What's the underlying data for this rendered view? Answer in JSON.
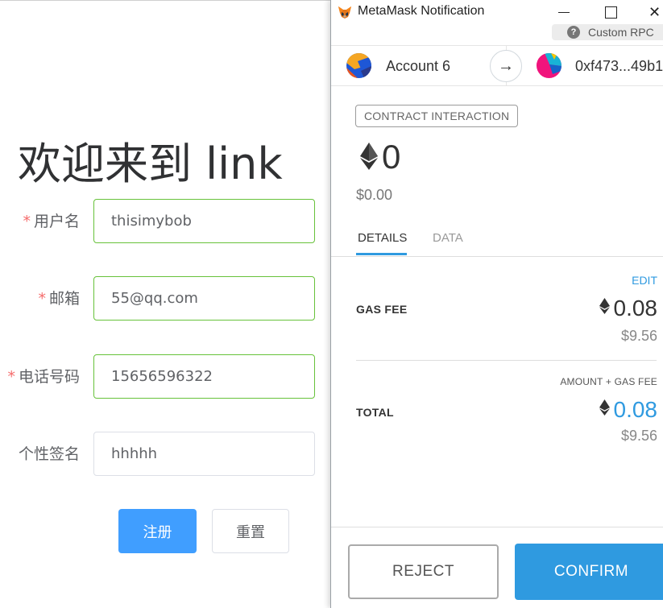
{
  "form": {
    "heading": "欢迎来到 link",
    "required_mark": "*",
    "fields": [
      {
        "label": "用户名",
        "value": "thisimybob",
        "required": true
      },
      {
        "label": "邮箱",
        "value": "55@qq.com",
        "required": true
      },
      {
        "label": "电话号码",
        "value": "15656596322",
        "required": true
      },
      {
        "label": "个性签名",
        "value": "hhhhh",
        "required": false
      }
    ],
    "register_label": "注册",
    "reset_label": "重置"
  },
  "metamask": {
    "window_title": "MetaMask Notification",
    "window_controls": {
      "close": "✕"
    },
    "network": "Custom RPC",
    "help_glyph": "?",
    "sender": "Account 6",
    "arrow_glyph": "→",
    "recipient": "0xf473...49b1",
    "tx_type": "CONTRACT INTERACTION",
    "amount": "0",
    "amount_fiat": "$0.00",
    "tabs": [
      {
        "label": "DETAILS",
        "active": true
      },
      {
        "label": "DATA",
        "active": false
      }
    ],
    "edit_label": "EDIT",
    "gas_fee": {
      "label": "GAS FEE",
      "value": "0.08",
      "fiat": "$9.56"
    },
    "total": {
      "subtitle": "AMOUNT + GAS FEE",
      "label": "TOTAL",
      "value": "0.08",
      "fiat": "$9.56"
    },
    "reject_label": "REJECT",
    "confirm_label": "CONFIRM"
  },
  "colors": {
    "valid_border": "#67c23a",
    "primary_blue": "#409eff",
    "required_red": "#f56c6c",
    "metamask_blue": "#2f9ae0"
  },
  "icons": {
    "fox": "metamask-fox-icon",
    "help": "help-icon",
    "arrow": "arrow-right-icon",
    "eth": "ethereum-icon",
    "avatar": "identicon-avatar"
  }
}
